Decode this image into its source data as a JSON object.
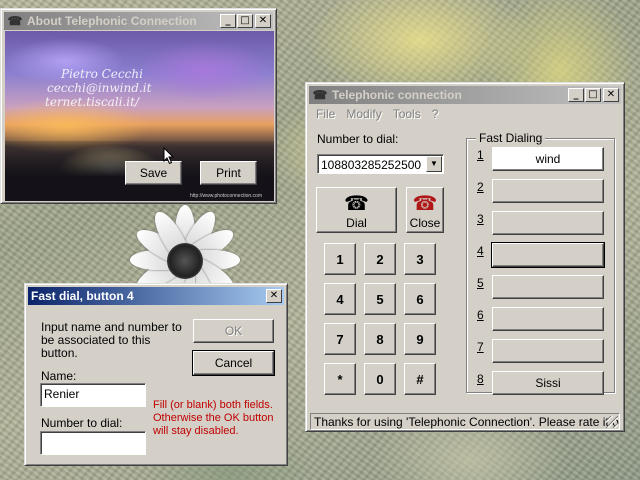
{
  "about_window": {
    "title": "About Telephonic Connection",
    "photo_text": [
      "Pietro Cecchi",
      "cecchi@inwind.it",
      "ternet.tiscali.it/"
    ],
    "photo_credit": "http://www.photoconnection.com",
    "buttons": {
      "save": "Save",
      "print": "Print"
    }
  },
  "phone_window": {
    "title": "Telephonic connection",
    "menu": [
      "File",
      "Modify",
      "Tools",
      "?"
    ],
    "number_label": "Number to dial:",
    "number_value": "108803285252500",
    "dial_label": "Dial",
    "close_label": "Close",
    "keypad": [
      "1",
      "2",
      "3",
      "4",
      "5",
      "6",
      "7",
      "8",
      "9",
      "*",
      "0",
      "#"
    ],
    "fast_dialing": {
      "title": "Fast Dialing",
      "entries": [
        {
          "num": "1",
          "name": "wind"
        },
        {
          "num": "2",
          "name": ""
        },
        {
          "num": "3",
          "name": ""
        },
        {
          "num": "4",
          "name": ""
        },
        {
          "num": "5",
          "name": ""
        },
        {
          "num": "6",
          "name": ""
        },
        {
          "num": "7",
          "name": ""
        },
        {
          "num": "8",
          "name": "Sissi"
        }
      ]
    },
    "status": "Thanks for using 'Telephonic Connection'. Please rate it on Pl"
  },
  "fastdial_dialog": {
    "title": "Fast dial, button 4",
    "instructions": "Input name and number to\nbe associated to this\nbutton.",
    "name_label": "Name:",
    "name_value": "Renier",
    "number_label": "Number to dial:",
    "number_value": "",
    "ok_label": "OK",
    "cancel_label": "Cancel",
    "note": "Fill (or blank) both fields.\nOtherwise the OK button\nwill stay disabled."
  },
  "window_buttons": {
    "minimize": "_",
    "maximize": "□",
    "close": "✕"
  },
  "colors": {
    "active_title": "#0a246a",
    "inactive_title": "#808080",
    "face": "#d4d0c8",
    "note_text": "#c00000"
  }
}
